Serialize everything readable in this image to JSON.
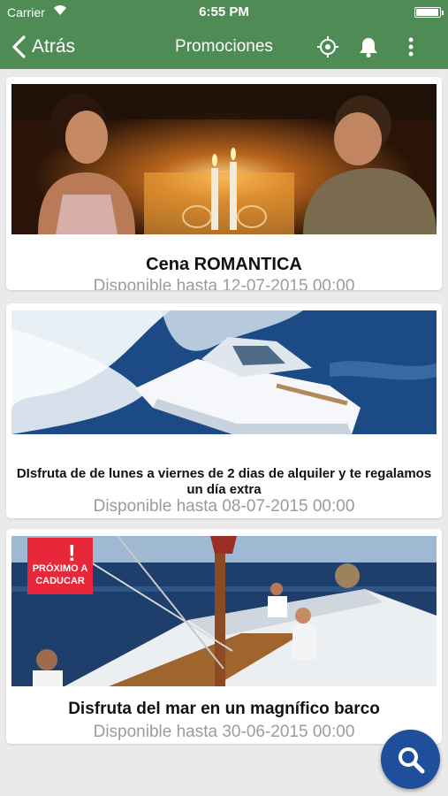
{
  "status_bar": {
    "carrier": "Carrier",
    "time": "6:55 PM",
    "battery_level": 0.95
  },
  "nav": {
    "back_label": "Atrás",
    "title": "Promociones"
  },
  "promotions": [
    {
      "title": "Cena ROMANTICA",
      "availability": "Disponible hasta 12-07-2015 00:00",
      "image": "romantic-candlelight-dinner"
    },
    {
      "title": "DIsfruta de  de lunes a viernes de 2 dias de alquiler y te regalamos un día extra",
      "availability": "Disponible hasta 08-07-2015 00:00",
      "image": "speedboat"
    },
    {
      "title": "Disfruta del mar en un magnífico barco",
      "availability": "Disponible hasta 30-06-2015 00:00",
      "image": "sailboat",
      "badge": "PRÓXIMO A CADUCAR"
    }
  ],
  "colors": {
    "header": "#4f8c55",
    "fab": "#1f4f9b",
    "badge": "#e8273a",
    "availability_text": "#9b9b9b"
  },
  "icons": {
    "back": "chevron-left-icon",
    "location": "crosshair-location-icon",
    "notifications": "bell-icon",
    "more": "more-vertical-icon",
    "search": "search-icon"
  }
}
